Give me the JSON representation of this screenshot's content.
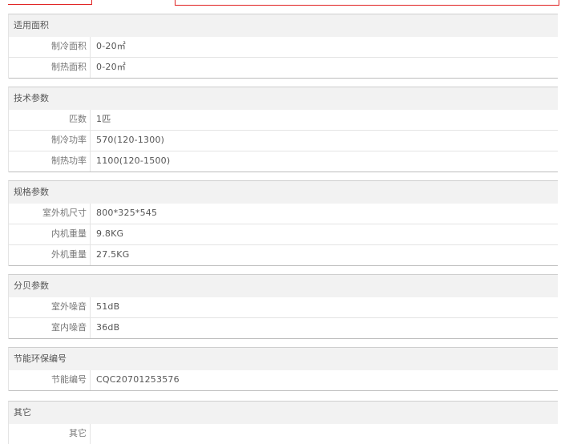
{
  "sections": [
    {
      "title": "适用面积",
      "rows": [
        {
          "label": "制冷面积",
          "value": "0-20㎡"
        },
        {
          "label": "制热面积",
          "value": "0-20㎡"
        }
      ]
    },
    {
      "title": "技术参数",
      "rows": [
        {
          "label": "匹数",
          "value": "1匹"
        },
        {
          "label": "制冷功率",
          "value": "570(120-1300)"
        },
        {
          "label": "制热功率",
          "value": "1100(120-1500)"
        }
      ]
    },
    {
      "title": "规格参数",
      "rows": [
        {
          "label": "室外机尺寸",
          "value": "800*325*545"
        },
        {
          "label": "内机重量",
          "value": "9.8KG"
        },
        {
          "label": "外机重量",
          "value": "27.5KG"
        }
      ]
    },
    {
      "title": "分贝参数",
      "rows": [
        {
          "label": "室外噪音",
          "value": "51dB"
        },
        {
          "label": "室内噪音",
          "value": "36dB"
        }
      ]
    },
    {
      "title": "节能环保编号",
      "rows": [
        {
          "label": "节能编号",
          "value": "CQC20701253576"
        }
      ]
    },
    {
      "title": "其它",
      "rows": [
        {
          "label": "其它",
          "value": ""
        }
      ]
    }
  ],
  "colors": {
    "accent": "#e02020",
    "header_bg": "#f2f2f2",
    "border": "#e4e4e4"
  }
}
